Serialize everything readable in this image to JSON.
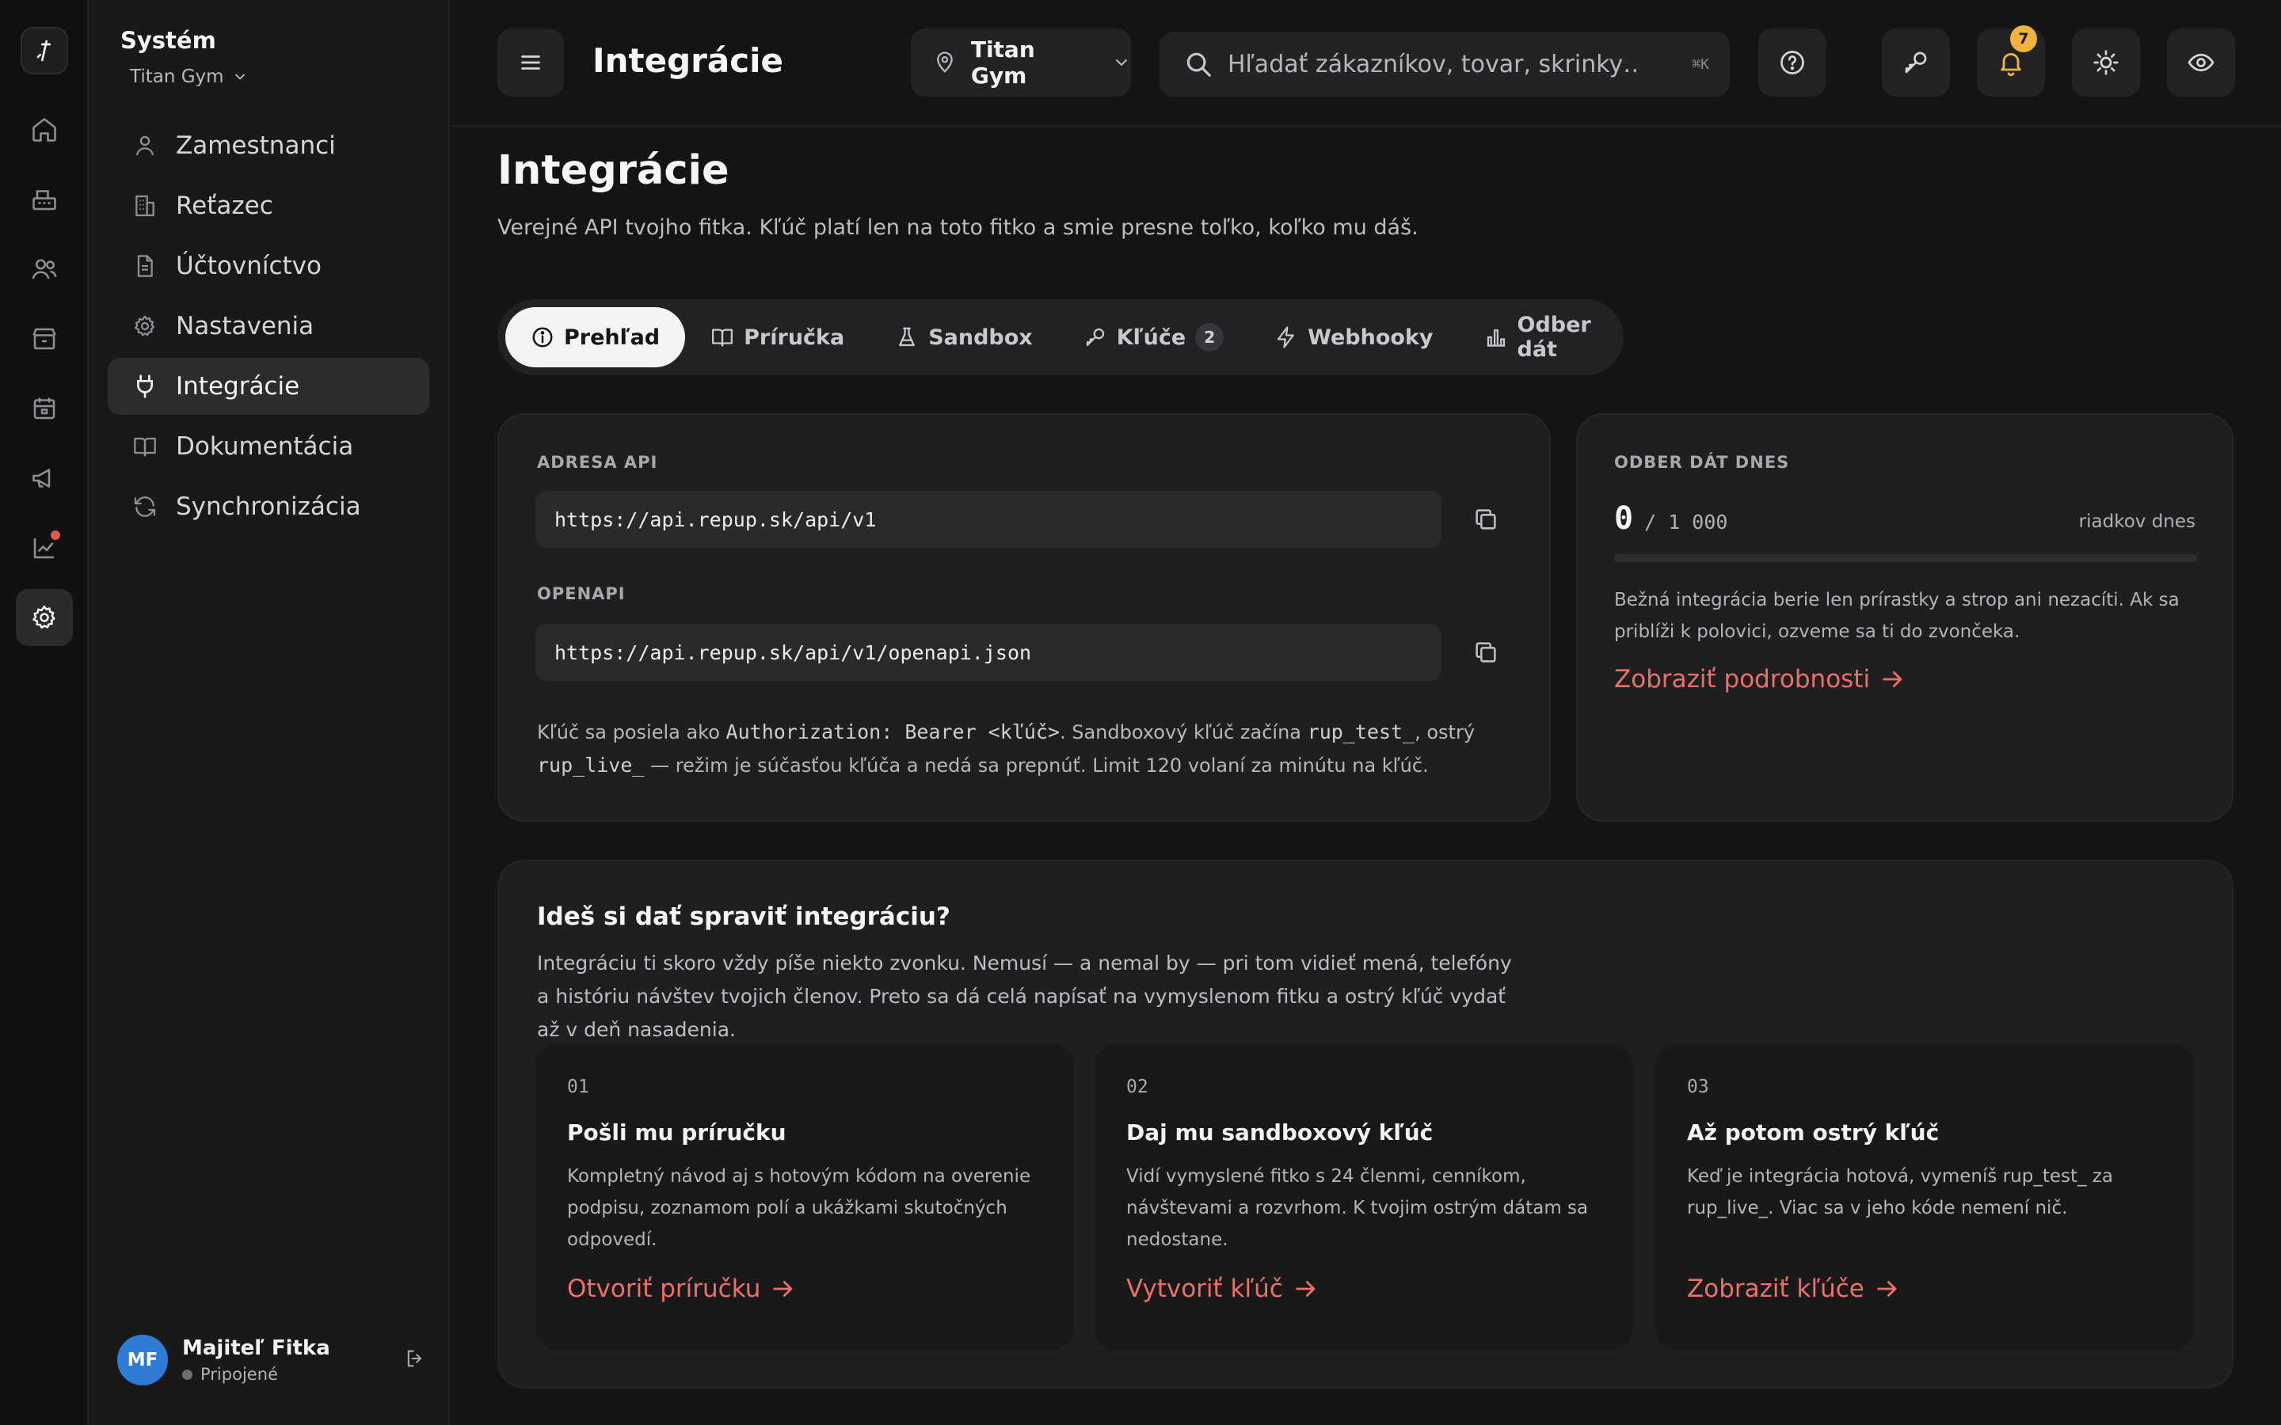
{
  "colors": {
    "accent": "#ee6f67",
    "badge": "#f0b43c",
    "avatar": "#2f7bd6",
    "background": "#141415"
  },
  "rail": {
    "items": [
      {
        "icon": "home-icon"
      },
      {
        "icon": "cash-register-icon"
      },
      {
        "icon": "users-icon"
      },
      {
        "icon": "store-icon"
      },
      {
        "icon": "calendar-icon"
      },
      {
        "icon": "megaphone-icon"
      },
      {
        "icon": "chart-icon",
        "has_alert": true
      },
      {
        "icon": "gear-icon",
        "active": true
      }
    ]
  },
  "sidebar": {
    "title": "Systém",
    "gym": "Titan Gym",
    "items": [
      {
        "label": "Zamestnanci",
        "icon": "person-icon"
      },
      {
        "label": "Reťazec",
        "icon": "building-icon"
      },
      {
        "label": "Účtovníctvo",
        "icon": "document-icon"
      },
      {
        "label": "Nastavenia",
        "icon": "gear-icon"
      },
      {
        "label": "Integrácie",
        "icon": "plug-icon",
        "active": true
      },
      {
        "label": "Dokumentácia",
        "icon": "book-icon"
      },
      {
        "label": "Synchronizácia",
        "icon": "sync-icon"
      }
    ],
    "user": {
      "initials": "MF",
      "name": "Majiteľ Fitka",
      "status": "Pripojené"
    }
  },
  "topbar": {
    "title": "Integrácie",
    "location": "Titan Gym",
    "search_placeholder": "Hľadať zákazníkov, tovar, skrinky…",
    "search_shortcut": "⌘K",
    "notification_count": "7"
  },
  "page": {
    "title": "Integrácie",
    "subtitle": "Verejné API tvojho fitka. Kľúč platí len na toto fitko a smie presne toľko, koľko mu dáš."
  },
  "tabs": [
    {
      "label": "Prehľad",
      "icon": "info-icon",
      "active": true
    },
    {
      "label": "Príručka",
      "icon": "book-icon"
    },
    {
      "label": "Sandbox",
      "icon": "flask-icon"
    },
    {
      "label": "Kľúče",
      "icon": "key-icon",
      "count": "2"
    },
    {
      "label": "Webhooky",
      "icon": "bolt-icon"
    },
    {
      "label": "Odber dát",
      "icon": "bar-chart-icon"
    }
  ],
  "api": {
    "address_label": "ADRESA API",
    "address": "https://api.repup.sk/api/v1",
    "openapi_label": "OPENAPI",
    "openapi": "https://api.repup.sk/api/v1/openapi.json",
    "note": {
      "p1": "Kľúč sa posiela ako ",
      "c1": "Authorization: Bearer <kľúč>",
      "p2": ". Sandboxový kľúč začína ",
      "c2": "rup_test_",
      "p3": ", ostrý ",
      "c3": "rup_live_",
      "p4": " — režim je súčasťou kľúča a nedá sa prepnúť. Limit 120 volaní za minútu na kľúč."
    }
  },
  "quota": {
    "label": "ODBER DÁT DNES",
    "used": "0",
    "max": "/ 1 000",
    "unit": "riadkov dnes",
    "used_fraction": 0,
    "description": "Bežná integrácia berie len prírastky a strop ani nezacíti. Ak sa priblíži k polovici, ozveme sa ti do zvončeka.",
    "link": "Zobraziť podrobnosti"
  },
  "cta": {
    "title": "Ideš si dať spraviť integráciu?",
    "text": "Integráciu ti skoro vždy píše niekto zvonku. Nemusí — a nemal by — pri tom vidieť mená, telefóny a históriu návštev tvojich členov. Preto sa dá celá napísať na vymyslenom fitku a ostrý kľúč vydať až v deň nasadenia.",
    "steps": [
      {
        "num": "01",
        "title": "Pošli mu príručku",
        "desc": "Kompletný návod aj s hotovým kódom na overenie podpisu, zoznamom polí a ukážkami skutočných odpovedí.",
        "link": "Otvoriť príručku"
      },
      {
        "num": "02",
        "title": "Daj mu sandboxový kľúč",
        "desc": "Vidí vymyslené fitko s 24 členmi, cenníkom, návštevami a rozvrhom. K tvojim ostrým dátam sa nedostane.",
        "link": "Vytvoriť kľúč"
      },
      {
        "num": "03",
        "title": "Až potom ostrý kľúč",
        "desc": "Keď je integrácia hotová, vymeníš rup_test_ za rup_live_. Viac sa v jeho kóde nemení nič.",
        "link": "Zobraziť kľúče"
      }
    ]
  }
}
